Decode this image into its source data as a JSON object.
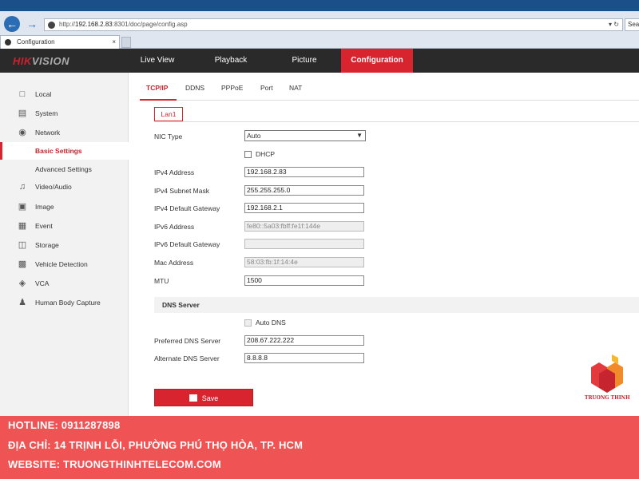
{
  "browser": {
    "address_prefix": "http://",
    "address_host": "192.168.2.83",
    "address_rest": ":8301/doc/page/config.asp",
    "search_placeholder": "Sea",
    "tab_title": "Configuration",
    "tab_close": "×",
    "addr_controls": "▾ ↻"
  },
  "header": {
    "logo_brand": "HIK",
    "logo_rest": "VISION",
    "menu": [
      {
        "label": "Live View"
      },
      {
        "label": "Playback"
      },
      {
        "label": "Picture"
      },
      {
        "label": "Configuration"
      }
    ]
  },
  "sidebar": {
    "items": [
      {
        "label": "Local",
        "icon": "monitor-icon"
      },
      {
        "label": "System",
        "icon": "system-icon"
      },
      {
        "label": "Network",
        "icon": "globe-icon"
      },
      {
        "label": "Basic Settings"
      },
      {
        "label": "Advanced Settings"
      },
      {
        "label": "Video/Audio",
        "icon": "video-audio-icon"
      },
      {
        "label": "Image",
        "icon": "image-icon"
      },
      {
        "label": "Event",
        "icon": "calendar-icon"
      },
      {
        "label": "Storage",
        "icon": "storage-icon"
      },
      {
        "label": "Vehicle Detection",
        "icon": "car-icon"
      },
      {
        "label": "VCA",
        "icon": "vca-icon"
      },
      {
        "label": "Human Body Capture",
        "icon": "person-icon"
      }
    ]
  },
  "subtabs": [
    "TCP/IP",
    "DDNS",
    "PPPoE",
    "Port",
    "NAT"
  ],
  "lan_tab": "Lan1",
  "form": {
    "nic_type_label": "NIC Type",
    "nic_type_value": "Auto",
    "dhcp_label": "DHCP",
    "ipv4_address_label": "IPv4 Address",
    "ipv4_address_value": "192.168.2.83",
    "ipv4_mask_label": "IPv4 Subnet Mask",
    "ipv4_mask_value": "255.255.255.0",
    "ipv4_gateway_label": "IPv4 Default Gateway",
    "ipv4_gateway_value": "192.168.2.1",
    "ipv6_address_label": "IPv6 Address",
    "ipv6_address_value": "fe80::5a03:fbff:fe1f:144e",
    "ipv6_gateway_label": "IPv6 Default Gateway",
    "ipv6_gateway_value": "",
    "mac_label": "Mac Address",
    "mac_value": "58:03:fb:1f:14:4e",
    "mtu_label": "MTU",
    "mtu_value": "1500",
    "dns_section": "DNS Server",
    "auto_dns_label": "Auto DNS",
    "preferred_dns_label": "Preferred DNS Server",
    "preferred_dns_value": "208.67.222.222",
    "alternate_dns_label": "Alternate DNS Server",
    "alternate_dns_value": "8.8.8.8",
    "save_label": "Save"
  },
  "watermark": "TRUONG THINH",
  "banner": {
    "hotline": "HOTLINE: 0911287898",
    "address": "ĐỊA CHỈ: 14 TRỊNH LỖI, PHƯỜNG PHÚ THỌ HÒA, TP. HCM",
    "website": "WEBSITE: TRUONGTHINHTELECOM.COM"
  },
  "colors": {
    "accent": "#d7242f",
    "header_bg": "#2a2a2a",
    "banner_bg": "#ef5354"
  }
}
